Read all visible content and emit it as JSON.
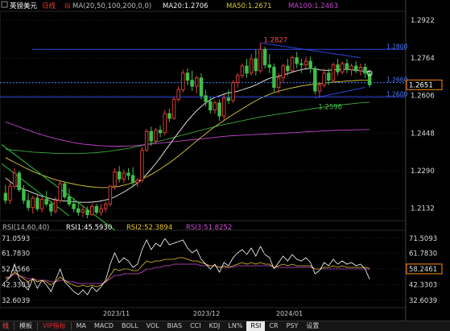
{
  "colors": {
    "up": "#e8413c",
    "down": "#3fbe4a",
    "background": "#000000",
    "grid": "#2a2a2a",
    "ma20": "#f0f0f0",
    "ma50": "#d8c83a",
    "ma100": "#c145c8",
    "ma200": "#3ba83b",
    "hline": "#2f45e0",
    "dashline": "#4a7cff",
    "trend_green": "#2fc42f",
    "rsi1": "#ffffff",
    "rsi2": "#e6c82a",
    "rsi3": "#d24ad8",
    "price_box": "#ff8c00"
  },
  "header": {
    "instrument": "英镑美元",
    "period": "日线",
    "ma_settings": "MA(20,50,100,200,0,0)",
    "ma20": "MA20:1.2706",
    "ma50": "MA50:1.2671",
    "ma100": "MA100:1.2463"
  },
  "price_axis": {
    "ticks": [
      "1.2922",
      "1.2764",
      "1.2606",
      "1.2448",
      "1.2290",
      "1.2132"
    ],
    "current_price": "1.2651"
  },
  "annotations": {
    "high_label": "1.2827",
    "low_label": "1.2596",
    "level_top": "1.2800",
    "level_dash_1": "1.2660",
    "level_dash_2": "1.2600"
  },
  "rsi_header": {
    "settings": "RSI(14,60,40)",
    "rsi1": "RSI1:45.5930",
    "rsi2": "RSI2:52.3894",
    "rsi3": "RSI3:51.8252"
  },
  "rsi_axis_left": [
    "71.0593",
    "61.7830",
    "52.0566",
    "42.3303",
    "32.6039"
  ],
  "rsi_axis_right": [
    "71.5093",
    "61.7830",
    "58.2461",
    "42.3303",
    "32.6039"
  ],
  "dates": [
    "2023/11",
    "2023/12",
    "2024/01"
  ],
  "toolbar": {
    "items": [
      "线",
      "模板",
      "VIP指标",
      "MA",
      "MACD",
      "BOLL",
      "VOL",
      "BIAS",
      "CCI",
      "KDJ",
      "LN%",
      "RSI",
      "CR",
      "PSY",
      "设置"
    ],
    "active": "RSI"
  },
  "chart_data": {
    "type": "candlestick",
    "candles": [
      {
        "o": 1.2195,
        "h": 1.223,
        "l": 1.215,
        "c": 1.2165
      },
      {
        "o": 1.2165,
        "h": 1.224,
        "l": 1.215,
        "c": 1.2225
      },
      {
        "o": 1.2225,
        "h": 1.23,
        "l": 1.2215,
        "c": 1.228
      },
      {
        "o": 1.228,
        "h": 1.229,
        "l": 1.22,
        "c": 1.221
      },
      {
        "o": 1.221,
        "h": 1.223,
        "l": 1.215,
        "c": 1.2165
      },
      {
        "o": 1.2165,
        "h": 1.2195,
        "l": 1.212,
        "c": 1.2135
      },
      {
        "o": 1.2135,
        "h": 1.2185,
        "l": 1.211,
        "c": 1.2175
      },
      {
        "o": 1.2175,
        "h": 1.2195,
        "l": 1.212,
        "c": 1.213
      },
      {
        "o": 1.213,
        "h": 1.218,
        "l": 1.2115,
        "c": 1.217
      },
      {
        "o": 1.217,
        "h": 1.2205,
        "l": 1.214,
        "c": 1.215
      },
      {
        "o": 1.215,
        "h": 1.216,
        "l": 1.21,
        "c": 1.212
      },
      {
        "o": 1.212,
        "h": 1.218,
        "l": 1.211,
        "c": 1.2165
      },
      {
        "o": 1.2165,
        "h": 1.225,
        "l": 1.2155,
        "c": 1.2235
      },
      {
        "o": 1.2235,
        "h": 1.2245,
        "l": 1.217,
        "c": 1.218
      },
      {
        "o": 1.218,
        "h": 1.2215,
        "l": 1.214,
        "c": 1.215
      },
      {
        "o": 1.215,
        "h": 1.2175,
        "l": 1.2115,
        "c": 1.213
      },
      {
        "o": 1.213,
        "h": 1.216,
        "l": 1.21,
        "c": 1.2115
      },
      {
        "o": 1.2115,
        "h": 1.2145,
        "l": 1.2095,
        "c": 1.2125
      },
      {
        "o": 1.2125,
        "h": 1.214,
        "l": 1.209,
        "c": 1.2105
      },
      {
        "o": 1.2105,
        "h": 1.215,
        "l": 1.21,
        "c": 1.214
      },
      {
        "o": 1.214,
        "h": 1.215,
        "l": 1.2105,
        "c": 1.2115
      },
      {
        "o": 1.2115,
        "h": 1.215,
        "l": 1.21,
        "c": 1.213
      },
      {
        "o": 1.213,
        "h": 1.216,
        "l": 1.2115,
        "c": 1.215
      },
      {
        "o": 1.215,
        "h": 1.223,
        "l": 1.214,
        "c": 1.2225
      },
      {
        "o": 1.2225,
        "h": 1.23,
        "l": 1.221,
        "c": 1.2285
      },
      {
        "o": 1.2285,
        "h": 1.231,
        "l": 1.224,
        "c": 1.2255
      },
      {
        "o": 1.2255,
        "h": 1.2295,
        "l": 1.224,
        "c": 1.228
      },
      {
        "o": 1.228,
        "h": 1.23,
        "l": 1.225,
        "c": 1.227
      },
      {
        "o": 1.227,
        "h": 1.2305,
        "l": 1.222,
        "c": 1.224
      },
      {
        "o": 1.224,
        "h": 1.226,
        "l": 1.222,
        "c": 1.225
      },
      {
        "o": 1.225,
        "h": 1.239,
        "l": 1.224,
        "c": 1.2375
      },
      {
        "o": 1.2375,
        "h": 1.2465,
        "l": 1.237,
        "c": 1.2455
      },
      {
        "o": 1.2455,
        "h": 1.2475,
        "l": 1.2395,
        "c": 1.2415
      },
      {
        "o": 1.2415,
        "h": 1.247,
        "l": 1.2405,
        "c": 1.246
      },
      {
        "o": 1.246,
        "h": 1.248,
        "l": 1.243,
        "c": 1.245
      },
      {
        "o": 1.245,
        "h": 1.2545,
        "l": 1.244,
        "c": 1.253
      },
      {
        "o": 1.253,
        "h": 1.255,
        "l": 1.2495,
        "c": 1.251
      },
      {
        "o": 1.251,
        "h": 1.26,
        "l": 1.2505,
        "c": 1.259
      },
      {
        "o": 1.259,
        "h": 1.2645,
        "l": 1.258,
        "c": 1.263
      },
      {
        "o": 1.263,
        "h": 1.2715,
        "l": 1.262,
        "c": 1.27
      },
      {
        "o": 1.27,
        "h": 1.272,
        "l": 1.265,
        "c": 1.267
      },
      {
        "o": 1.267,
        "h": 1.271,
        "l": 1.2625,
        "c": 1.2645
      },
      {
        "o": 1.2645,
        "h": 1.269,
        "l": 1.2615,
        "c": 1.268
      },
      {
        "o": 1.268,
        "h": 1.27,
        "l": 1.259,
        "c": 1.2605
      },
      {
        "o": 1.2605,
        "h": 1.263,
        "l": 1.256,
        "c": 1.258
      },
      {
        "o": 1.258,
        "h": 1.26,
        "l": 1.253,
        "c": 1.2545
      },
      {
        "o": 1.2545,
        "h": 1.2585,
        "l": 1.253,
        "c": 1.2575
      },
      {
        "o": 1.2575,
        "h": 1.259,
        "l": 1.25,
        "c": 1.252
      },
      {
        "o": 1.252,
        "h": 1.261,
        "l": 1.2505,
        "c": 1.2595
      },
      {
        "o": 1.2595,
        "h": 1.263,
        "l": 1.257,
        "c": 1.2585
      },
      {
        "o": 1.2585,
        "h": 1.267,
        "l": 1.2575,
        "c": 1.266
      },
      {
        "o": 1.266,
        "h": 1.27,
        "l": 1.264,
        "c": 1.269
      },
      {
        "o": 1.269,
        "h": 1.274,
        "l": 1.268,
        "c": 1.273
      },
      {
        "o": 1.273,
        "h": 1.276,
        "l": 1.268,
        "c": 1.27
      },
      {
        "o": 1.27,
        "h": 1.278,
        "l": 1.269,
        "c": 1.276
      },
      {
        "o": 1.276,
        "h": 1.28,
        "l": 1.269,
        "c": 1.271
      },
      {
        "o": 1.271,
        "h": 1.2827,
        "l": 1.27,
        "c": 1.28
      },
      {
        "o": 1.28,
        "h": 1.281,
        "l": 1.272,
        "c": 1.2735
      },
      {
        "o": 1.2735,
        "h": 1.278,
        "l": 1.27,
        "c": 1.2725
      },
      {
        "o": 1.2725,
        "h": 1.274,
        "l": 1.262,
        "c": 1.264
      },
      {
        "o": 1.264,
        "h": 1.27,
        "l": 1.2615,
        "c": 1.268
      },
      {
        "o": 1.268,
        "h": 1.274,
        "l": 1.266,
        "c": 1.273
      },
      {
        "o": 1.273,
        "h": 1.276,
        "l": 1.269,
        "c": 1.271
      },
      {
        "o": 1.271,
        "h": 1.2775,
        "l": 1.27,
        "c": 1.2765
      },
      {
        "o": 1.2765,
        "h": 1.279,
        "l": 1.272,
        "c": 1.274
      },
      {
        "o": 1.274,
        "h": 1.276,
        "l": 1.27,
        "c": 1.2735
      },
      {
        "o": 1.2735,
        "h": 1.277,
        "l": 1.272,
        "c": 1.275
      },
      {
        "o": 1.275,
        "h": 1.277,
        "l": 1.27,
        "c": 1.272
      },
      {
        "o": 1.272,
        "h": 1.273,
        "l": 1.261,
        "c": 1.2625
      },
      {
        "o": 1.2625,
        "h": 1.266,
        "l": 1.2596,
        "c": 1.265
      },
      {
        "o": 1.265,
        "h": 1.272,
        "l": 1.264,
        "c": 1.27
      },
      {
        "o": 1.27,
        "h": 1.272,
        "l": 1.265,
        "c": 1.267
      },
      {
        "o": 1.267,
        "h": 1.2745,
        "l": 1.266,
        "c": 1.2735
      },
      {
        "o": 1.2735,
        "h": 1.276,
        "l": 1.269,
        "c": 1.2705
      },
      {
        "o": 1.2705,
        "h": 1.275,
        "l": 1.2695,
        "c": 1.274
      },
      {
        "o": 1.274,
        "h": 1.276,
        "l": 1.27,
        "c": 1.2715
      },
      {
        "o": 1.2715,
        "h": 1.274,
        "l": 1.269,
        "c": 1.273
      },
      {
        "o": 1.273,
        "h": 1.275,
        "l": 1.27,
        "c": 1.271
      },
      {
        "o": 1.271,
        "h": 1.274,
        "l": 1.269,
        "c": 1.2725
      },
      {
        "o": 1.2725,
        "h": 1.274,
        "l": 1.268,
        "c": 1.27
      },
      {
        "o": 1.27,
        "h": 1.271,
        "l": 1.264,
        "c": 1.2651
      }
    ],
    "ma20": [
      1.226,
      1.2245,
      1.223,
      1.222,
      1.2212,
      1.2205,
      1.2197,
      1.219,
      1.2183,
      1.2177,
      1.2172,
      1.2168,
      1.2165,
      1.2163,
      1.2162,
      1.216,
      1.2158,
      1.2157,
      1.2157,
      1.2158,
      1.216,
      1.2163,
      1.2167,
      1.2172,
      1.218,
      1.219,
      1.22,
      1.2212,
      1.2225,
      1.2238,
      1.2255,
      1.2275,
      1.2297,
      1.232,
      1.2345,
      1.2372,
      1.2398,
      1.2425,
      1.245,
      1.2475,
      1.25,
      1.2522,
      1.2542,
      1.256,
      1.2575,
      1.2588,
      1.2598,
      1.2605,
      1.2612,
      1.2617,
      1.262,
      1.2624,
      1.263,
      1.2636,
      1.2643,
      1.265,
      1.266,
      1.267,
      1.2678,
      1.2683,
      1.2687,
      1.2692,
      1.2698,
      1.2704,
      1.271,
      1.2715,
      1.2718,
      1.272,
      1.2718,
      1.2714,
      1.2712,
      1.2712,
      1.2714,
      1.2715,
      1.2716,
      1.2716,
      1.2714,
      1.2712,
      1.271,
      1.2708,
      1.2706
    ],
    "ma50": [
      1.2345,
      1.2335,
      1.2325,
      1.2315,
      1.2305,
      1.2296,
      1.2287,
      1.2279,
      1.2272,
      1.2265,
      1.2258,
      1.2252,
      1.2247,
      1.2242,
      1.2238,
      1.2234,
      1.223,
      1.2227,
      1.2224,
      1.2222,
      1.222,
      1.2219,
      1.2219,
      1.222,
      1.2222,
      1.2225,
      1.2229,
      1.2234,
      1.224,
      1.2247,
      1.2255,
      1.2264,
      1.2274,
      1.2285,
      1.2297,
      1.231,
      1.2323,
      1.2337,
      1.2352,
      1.2367,
      1.2383,
      1.2399,
      1.2415,
      1.2431,
      1.2446,
      1.2461,
      1.2475,
      1.2488,
      1.2501,
      1.2514,
      1.2526,
      1.2538,
      1.255,
      1.2562,
      1.2573,
      1.2584,
      1.2594,
      1.2603,
      1.2611,
      1.2618,
      1.2624,
      1.2629,
      1.2634,
      1.2638,
      1.2642,
      1.2646,
      1.2649,
      1.2652,
      1.2654,
      1.2656,
      1.2658,
      1.266,
      1.2662,
      1.2664,
      1.2665,
      1.2667,
      1.2668,
      1.2669,
      1.267,
      1.267,
      1.2671
    ],
    "ma100": [
      1.2495,
      1.2488,
      1.2481,
      1.2474,
      1.2467,
      1.246,
      1.2453,
      1.2447,
      1.2441,
      1.2435,
      1.243,
      1.2425,
      1.242,
      1.2416,
      1.2412,
      1.2408,
      1.2405,
      1.2402,
      1.24,
      1.2398,
      1.2396,
      1.2395,
      1.2394,
      1.2393,
      1.2393,
      1.2393,
      1.2393,
      1.2394,
      1.2395,
      1.2396,
      1.2398,
      1.24,
      1.2402,
      1.2404,
      1.2406,
      1.2408,
      1.241,
      1.2412,
      1.2414,
      1.2416,
      1.2418,
      1.242,
      1.2422,
      1.2424,
      1.2426,
      1.2428,
      1.243,
      1.2432,
      1.2434,
      1.2436,
      1.2437,
      1.2438,
      1.2439,
      1.244,
      1.2441,
      1.2442,
      1.2443,
      1.2444,
      1.2445,
      1.2446,
      1.2447,
      1.2448,
      1.2449,
      1.245,
      1.2451,
      1.2452,
      1.2453,
      1.2454,
      1.2455,
      1.2456,
      1.2457,
      1.2458,
      1.2459,
      1.246,
      1.246,
      1.2461,
      1.2461,
      1.2462,
      1.2462,
      1.2463,
      1.2463
    ],
    "ma200": [
      1.238,
      1.2378,
      1.2376,
      1.2374,
      1.2372,
      1.237,
      1.2368,
      1.2367,
      1.2366,
      1.2365,
      1.2364,
      1.2363,
      1.2362,
      1.2362,
      1.2362,
      1.2362,
      1.2362,
      1.2363,
      1.2364,
      1.2365,
      1.2366,
      1.2368,
      1.237,
      1.2372,
      1.2375,
      1.2378,
      1.2381,
      1.2384,
      1.2388,
      1.2392,
      1.2396,
      1.24,
      1.2405,
      1.241,
      1.2415,
      1.242,
      1.2425,
      1.243,
      1.2435,
      1.244,
      1.2445,
      1.245,
      1.2455,
      1.246,
      1.2465,
      1.247,
      1.2475,
      1.248,
      1.2484,
      1.2488,
      1.2492,
      1.2496,
      1.25,
      1.2504,
      1.2508,
      1.2512,
      1.2516,
      1.2519,
      1.2522,
      1.2525,
      1.2528,
      1.2531,
      1.2534,
      1.2537,
      1.254,
      1.2543,
      1.2546,
      1.2549,
      1.2552,
      1.2555,
      1.2558,
      1.2561,
      1.2563,
      1.2565,
      1.2567,
      1.2569,
      1.2571,
      1.2573,
      1.2575,
      1.2577,
      1.2578
    ],
    "rsi1": [
      44,
      47,
      55,
      46,
      42,
      39,
      46,
      40,
      45,
      42,
      38,
      45,
      52,
      44,
      41,
      38,
      36,
      39,
      36,
      41,
      38,
      41,
      45,
      55,
      62,
      56,
      59,
      57,
      53,
      55,
      64,
      70,
      64,
      68,
      66,
      71,
      67,
      68,
      69,
      70,
      65,
      62,
      64,
      58,
      55,
      52,
      55,
      50,
      56,
      54,
      59,
      62,
      64,
      61,
      65,
      60,
      66,
      61,
      59,
      52,
      56,
      60,
      57,
      61,
      58,
      57,
      59,
      56,
      49,
      51,
      56,
      54,
      58,
      55,
      57,
      55,
      56,
      54,
      55,
      52,
      45.6
    ],
    "rsi2": [
      46,
      47,
      50,
      48,
      46,
      44,
      46,
      44,
      45,
      44,
      42,
      44,
      47,
      45,
      43,
      42,
      41,
      42,
      41,
      42,
      41,
      42,
      44,
      48,
      52,
      51,
      52,
      52,
      51,
      51,
      54,
      57,
      56,
      57,
      57,
      58,
      58,
      58,
      59,
      59,
      58,
      57,
      57,
      56,
      55,
      54,
      54,
      53,
      54,
      53,
      54,
      55,
      56,
      55,
      56,
      55,
      56,
      55,
      55,
      53,
      54,
      55,
      54,
      55,
      54,
      54,
      54,
      54,
      52,
      52,
      53,
      53,
      54,
      53,
      54,
      53,
      53,
      53,
      53,
      53,
      52.4
    ],
    "rsi3": [
      47,
      47,
      49,
      48,
      47,
      46,
      46,
      45,
      45,
      45,
      44,
      44,
      45,
      45,
      44,
      44,
      43,
      43,
      43,
      43,
      43,
      43,
      44,
      46,
      48,
      48,
      49,
      49,
      49,
      49,
      50,
      52,
      52,
      53,
      53,
      54,
      54,
      55,
      55,
      55,
      55,
      55,
      55,
      54,
      54,
      54,
      54,
      53,
      53,
      53,
      53,
      54,
      54,
      54,
      54,
      54,
      54,
      54,
      54,
      53,
      53,
      53,
      53,
      53,
      53,
      53,
      53,
      53,
      52,
      52,
      52,
      52,
      52,
      52,
      52,
      52,
      52,
      52,
      52,
      52,
      51.8
    ],
    "y_range": [
      1.208,
      1.296
    ],
    "rsi_range": [
      30,
      74
    ]
  }
}
